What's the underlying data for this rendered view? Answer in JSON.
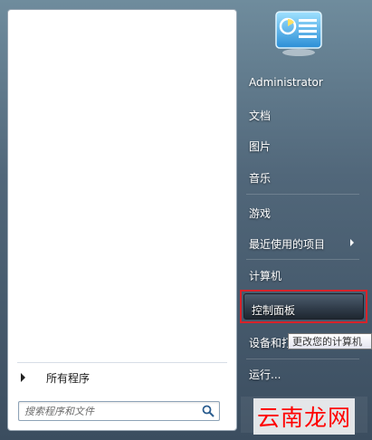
{
  "left_pane": {
    "all_programs_label": "所有程序",
    "search": {
      "placeholder": "搜索程序和文件"
    }
  },
  "right_pane": {
    "items": [
      {
        "label": "Administrator"
      },
      {
        "label": "文档"
      },
      {
        "label": "图片"
      },
      {
        "label": "音乐"
      },
      {
        "label": "游戏"
      },
      {
        "label": "最近使用的项目",
        "has_submenu": true
      },
      {
        "label": "计算机"
      },
      {
        "label": "控制面板",
        "highlighted": true
      },
      {
        "label": "设备和打"
      },
      {
        "label": "运行..."
      }
    ]
  },
  "tooltip": {
    "text": "更改您的计算机"
  },
  "watermark": {
    "text": "云南龙网"
  },
  "colors": {
    "highlight_border": "#d8232a",
    "watermark": "#ff0000"
  }
}
